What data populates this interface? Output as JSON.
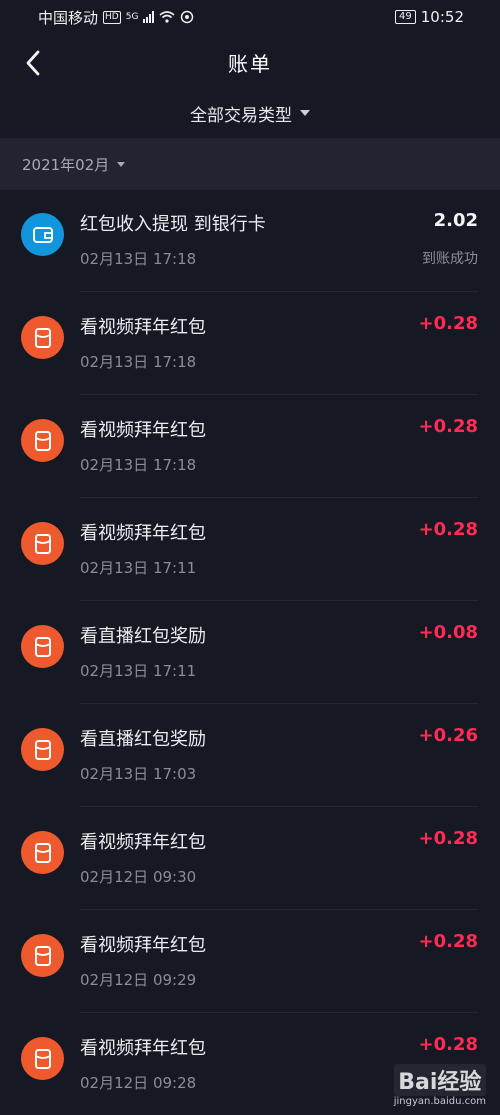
{
  "status_bar": {
    "carrier": "中国移动",
    "hd": "HD",
    "network": "5G",
    "battery": "49",
    "time": "10:52"
  },
  "header": {
    "title": "账单",
    "filter_label": "全部交易类型"
  },
  "month": "2021年02月",
  "transactions": [
    {
      "title": "红包收入提现 到银行卡",
      "time": "02月13日 17:18",
      "amount": "2.02",
      "status": "到账成功",
      "icon": "wallet-icon"
    },
    {
      "title": "看视频拜年红包",
      "time": "02月13日 17:18",
      "amount": "+0.28",
      "icon": "red-packet-icon"
    },
    {
      "title": "看视频拜年红包",
      "time": "02月13日 17:18",
      "amount": "+0.28",
      "icon": "red-packet-icon"
    },
    {
      "title": "看视频拜年红包",
      "time": "02月13日 17:11",
      "amount": "+0.28",
      "icon": "red-packet-icon"
    },
    {
      "title": "看直播红包奖励",
      "time": "02月13日 17:11",
      "amount": "+0.08",
      "icon": "red-packet-icon"
    },
    {
      "title": "看直播红包奖励",
      "time": "02月13日 17:03",
      "amount": "+0.26",
      "icon": "red-packet-icon"
    },
    {
      "title": "看视频拜年红包",
      "time": "02月12日 09:30",
      "amount": "+0.28",
      "icon": "red-packet-icon"
    },
    {
      "title": "看视频拜年红包",
      "time": "02月12日 09:29",
      "amount": "+0.28",
      "icon": "red-packet-icon"
    },
    {
      "title": "看视频拜年红包",
      "time": "02月12日 09:28",
      "amount": "+0.28",
      "icon": "red-packet-icon"
    }
  ],
  "watermark": {
    "main": "Bai经验",
    "sub": "jingyan.baidu.com"
  },
  "colors": {
    "background": "#161823",
    "positive_amount": "#fe2c55",
    "wallet_icon_bg": "#1296db",
    "packet_icon_bg": "#ee5a2d"
  }
}
